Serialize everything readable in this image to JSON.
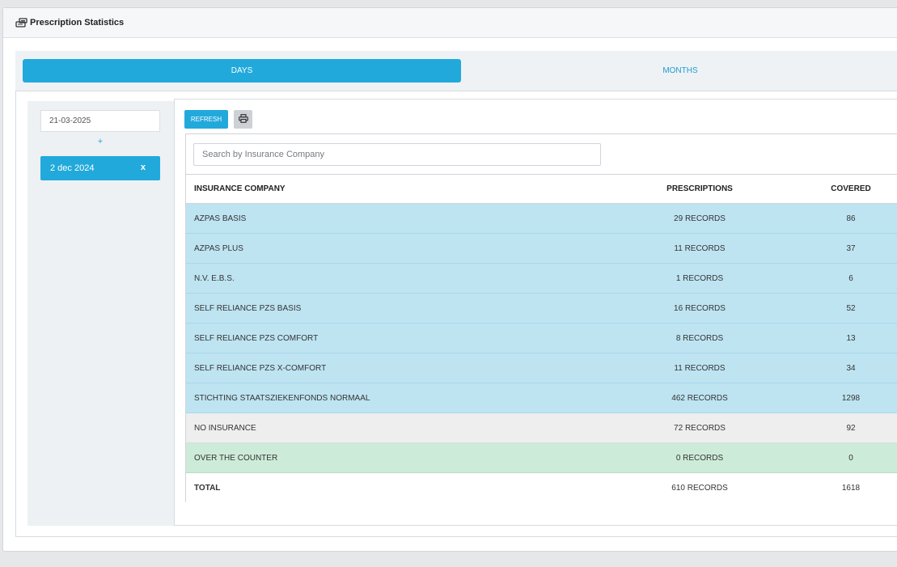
{
  "panel": {
    "title": "Prescription Statistics",
    "icon": "cash-register-icon"
  },
  "tabs": [
    {
      "label": "DAYS",
      "active": true
    },
    {
      "label": "MONTHS",
      "active": false
    }
  ],
  "dates": {
    "input_value": "21-03-2025",
    "add_label": "+",
    "selected": [
      {
        "label": "2 dec 2024",
        "remove": "x"
      }
    ]
  },
  "toolbar": {
    "refresh_label": "REFRESH",
    "print_icon": "printer-icon"
  },
  "search": {
    "placeholder": "Search by Insurance Company"
  },
  "table": {
    "columns": [
      "INSURANCE COMPANY",
      "PRESCRIPTIONS",
      "COVERED"
    ],
    "rows": [
      {
        "company": "AZPAS BASIS",
        "prescriptions": "29 RECORDS",
        "covered": "86",
        "style": "blue"
      },
      {
        "company": "AZPAS PLUS",
        "prescriptions": "11 RECORDS",
        "covered": "37",
        "style": "blue"
      },
      {
        "company": "N.V. E.B.S.",
        "prescriptions": "1 RECORDS",
        "covered": "6",
        "style": "blue"
      },
      {
        "company": "SELF RELIANCE PZS BASIS",
        "prescriptions": "16 RECORDS",
        "covered": "52",
        "style": "blue"
      },
      {
        "company": "SELF RELIANCE PZS COMFORT",
        "prescriptions": "8 RECORDS",
        "covered": "13",
        "style": "blue"
      },
      {
        "company": "SELF RELIANCE PZS X-COMFORT",
        "prescriptions": "11 RECORDS",
        "covered": "34",
        "style": "blue"
      },
      {
        "company": "STICHTING STAATSZIEKENFONDS NORMAAL",
        "prescriptions": "462 RECORDS",
        "covered": "1298",
        "style": "blue"
      },
      {
        "company": "NO INSURANCE",
        "prescriptions": "72 RECORDS",
        "covered": "92",
        "style": "grey"
      },
      {
        "company": "OVER THE COUNTER",
        "prescriptions": "0 RECORDS",
        "covered": "0",
        "style": "green"
      }
    ],
    "total": {
      "label": "TOTAL",
      "prescriptions": "610 RECORDS",
      "covered": "1618"
    }
  },
  "colors": {
    "accent": "#22a9db",
    "insured_row": "#bee4f2",
    "uninsured_row": "#eeeeef",
    "otc_row": "#cdebd9"
  }
}
